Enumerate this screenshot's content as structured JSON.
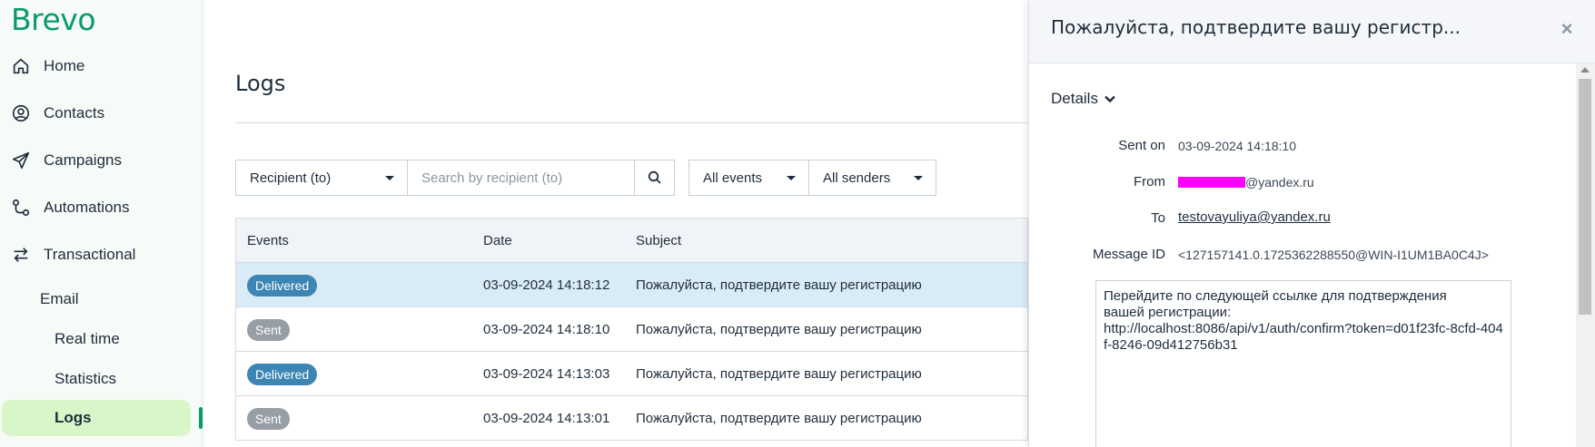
{
  "app": {
    "logo": "Brevo"
  },
  "sidebar": {
    "items": [
      {
        "label": "Home",
        "icon": "home-icon"
      },
      {
        "label": "Contacts",
        "icon": "contacts-icon"
      },
      {
        "label": "Campaigns",
        "icon": "send-icon"
      },
      {
        "label": "Automations",
        "icon": "automations-icon"
      },
      {
        "label": "Transactional",
        "icon": "transfer-icon"
      }
    ],
    "email": "Email",
    "realtime": "Real time",
    "statistics": "Statistics",
    "logs": "Logs"
  },
  "main": {
    "title": "Logs",
    "filters": {
      "recipient": "Recipient (to)",
      "search_placeholder": "Search by recipient (to)",
      "events": "All events",
      "senders": "All senders"
    },
    "table": {
      "headers": {
        "events": "Events",
        "date": "Date",
        "subject": "Subject"
      },
      "rows": [
        {
          "event": "Delivered",
          "date": "03-09-2024 14:18:12",
          "subject": "Пожалуйста, подтвердите вашу регистрацию"
        },
        {
          "event": "Sent",
          "date": "03-09-2024 14:18:10",
          "subject": "Пожалуйста, подтвердите вашу регистрацию"
        },
        {
          "event": "Delivered",
          "date": "03-09-2024 14:13:03",
          "subject": "Пожалуйста, подтвердите вашу регистрацию"
        },
        {
          "event": "Sent",
          "date": "03-09-2024 14:13:01",
          "subject": "Пожалуйста, подтвердите вашу регистрацию"
        }
      ]
    }
  },
  "panel": {
    "title": "Пожалуйста, подтвердите вашу регистр...",
    "close": "×",
    "details": "Details",
    "sent_on_label": "Sent on",
    "sent_on": "03-09-2024 14:18:10",
    "from_label": "From",
    "from_domain": "@yandex.ru",
    "to_label": "To",
    "to": "testovayuliya@yandex.ru",
    "message_id_label": "Message ID",
    "message_id": "<127157141.0.1725362288550@WIN-I1UM1BA0C4J>",
    "body_line1": "Перейдите по следующей ссылке для подтверждения",
    "body_line2": "вашей регистрации:",
    "body_line3": "http://localhost:8086/api/v1/auth/confirm?token=d01f23fc-8cfd-404f-8246-09d412756b31"
  },
  "colors": {
    "brand": "#0b996e",
    "active_bg": "#d9f6c8",
    "delivered": "#3d86b3",
    "sent": "#979ea6",
    "selected_row": "#d9ebf6",
    "redaction": "#ff00ff"
  }
}
